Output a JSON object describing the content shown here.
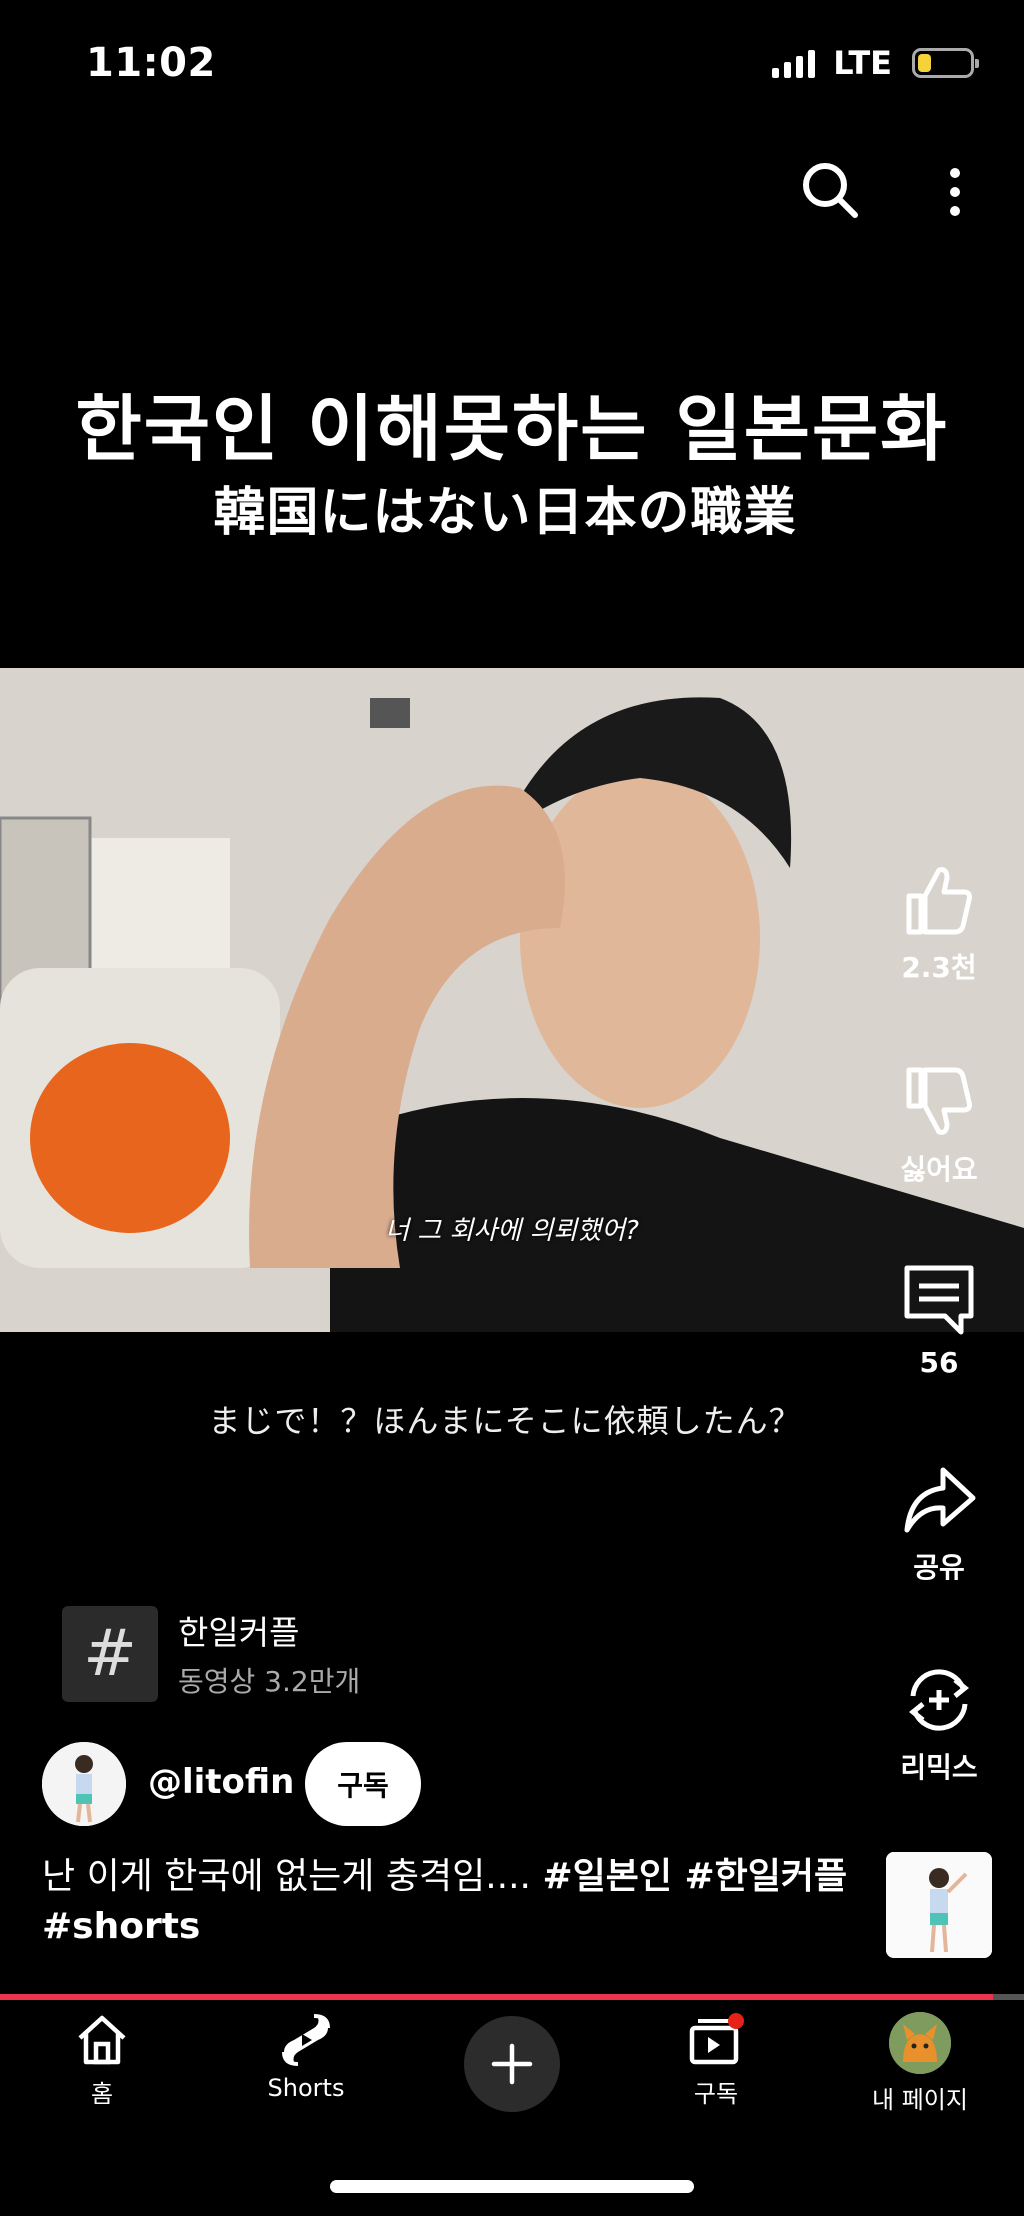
{
  "status_bar": {
    "time": "11:02",
    "network": "LTE",
    "battery_level": 0.25
  },
  "icons": {
    "search": "search-icon",
    "more": "more-vertical-icon",
    "like": "thumb-up-icon",
    "dislike": "thumb-down-icon",
    "comments": "comment-icon",
    "share": "share-icon",
    "remix": "remix-icon",
    "home": "home-icon",
    "shorts": "shorts-icon",
    "create": "plus-icon",
    "subscriptions": "subscriptions-icon"
  },
  "overlay": {
    "title_ko": "한국인 이해못하는 일본문화",
    "title_ja": "韓国にはない日本の職業",
    "video_subtitle": "너 그 회사에 의뢰했어?",
    "caption_ja": "まじで！？ほんまにそこに依頼したん？"
  },
  "actions": {
    "like_count": "2.3천",
    "dislike_label": "싫어요",
    "comment_count": "56",
    "share_label": "공유",
    "remix_label": "리믹스"
  },
  "hashtag": {
    "symbol": "#",
    "title": "한일커플",
    "subtitle": "동영상 3.2만개"
  },
  "channel": {
    "handle": "@litofin",
    "subscribe_label": "구독"
  },
  "description": {
    "text": "난 이게 한국에 없는게 충격임.... ",
    "tags": "#일본인 #한일커플 #shorts"
  },
  "progress": {
    "fraction": 0.97,
    "color": "#e9344e"
  },
  "bottom_nav": {
    "home": "홈",
    "shorts": "Shorts",
    "subscriptions": "구독",
    "profile": "내 페이지",
    "notification_dot_color": "#e62117"
  }
}
